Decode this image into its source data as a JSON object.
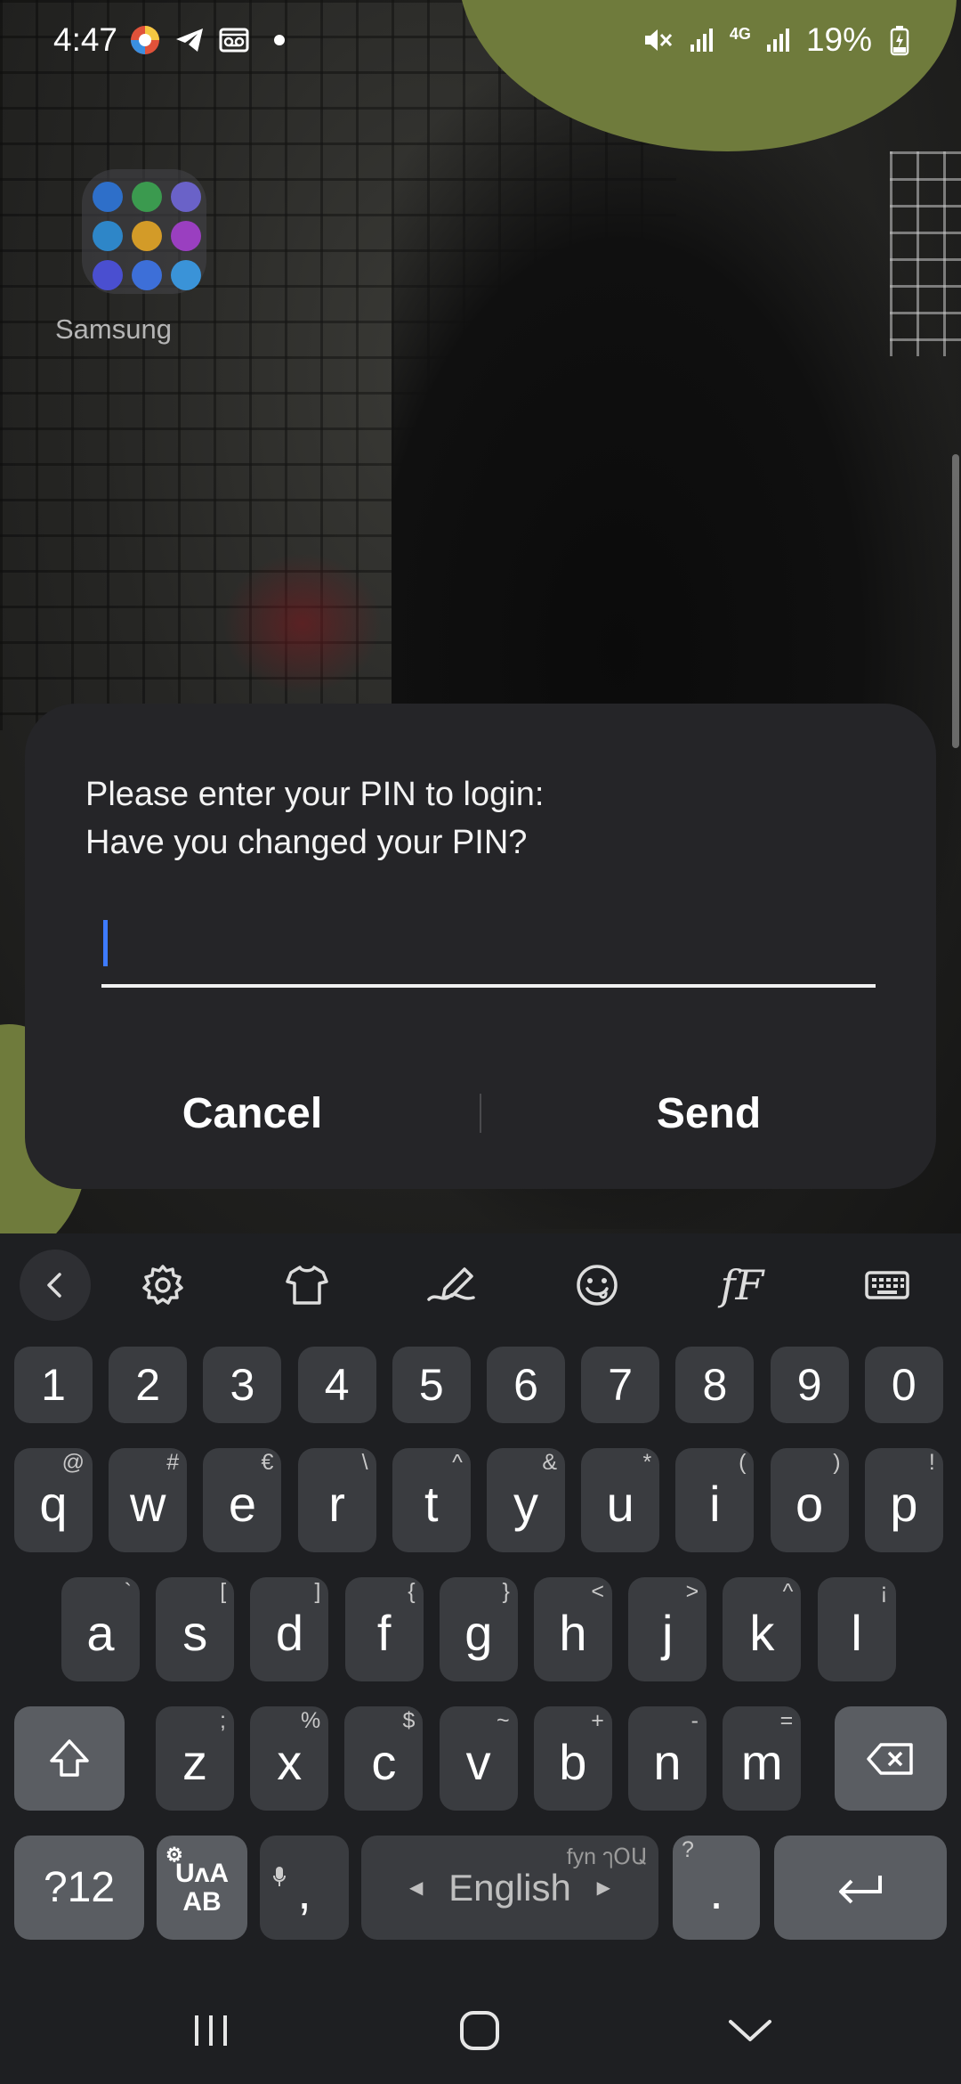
{
  "status_bar": {
    "time": "4:47",
    "network": "4G",
    "battery": "19%",
    "icons": [
      "browser-icon",
      "telegram-icon",
      "voicemail-icon",
      "dot-icon",
      "mute-icon",
      "signal-icon",
      "battery-charging-icon"
    ]
  },
  "home": {
    "folder_label": "Samsung",
    "folder_apps": [
      "#2e6fc9",
      "#3b9a4f",
      "#6a62c8",
      "#2e86c8",
      "#d39b28",
      "#9a3fc0",
      "#4a4fd0",
      "#3d6fd8",
      "#3a93d8"
    ]
  },
  "dialog": {
    "message_line1": "Please enter your PIN to login:",
    "message_line2": "Have you changed your PIN?",
    "pin_value": "",
    "cancel_label": "Cancel",
    "send_label": "Send",
    "cursor_color": "#3e7bff"
  },
  "keyboard": {
    "toolbar": [
      "back-icon",
      "gear-icon",
      "theme-shirt-icon",
      "handwriting-icon",
      "emoji-icon",
      "font-style-icon",
      "keyboard-icon"
    ],
    "font_style_label": "fF",
    "number_row": [
      "1",
      "2",
      "3",
      "4",
      "5",
      "6",
      "7",
      "8",
      "9",
      "0"
    ],
    "row1": [
      {
        "main": "q",
        "alt": "@"
      },
      {
        "main": "w",
        "alt": "#"
      },
      {
        "main": "e",
        "alt": "€"
      },
      {
        "main": "r",
        "alt": "\\"
      },
      {
        "main": "t",
        "alt": "^"
      },
      {
        "main": "y",
        "alt": "&"
      },
      {
        "main": "u",
        "alt": "*"
      },
      {
        "main": "i",
        "alt": "("
      },
      {
        "main": "o",
        "alt": ")"
      },
      {
        "main": "p",
        "alt": "!"
      }
    ],
    "row2": [
      {
        "main": "a",
        "alt": "`"
      },
      {
        "main": "s",
        "alt": "["
      },
      {
        "main": "d",
        "alt": "]"
      },
      {
        "main": "f",
        "alt": "{"
      },
      {
        "main": "g",
        "alt": "}"
      },
      {
        "main": "h",
        "alt": "<"
      },
      {
        "main": "j",
        "alt": ">"
      },
      {
        "main": "k",
        "alt": "^"
      },
      {
        "main": "l",
        "alt": "¡"
      }
    ],
    "row3": [
      {
        "main": "z",
        "alt": ";"
      },
      {
        "main": "x",
        "alt": "%"
      },
      {
        "main": "c",
        "alt": "$"
      },
      {
        "main": "v",
        "alt": "~"
      },
      {
        "main": "b",
        "alt": "+"
      },
      {
        "main": "n",
        "alt": "-"
      },
      {
        "main": "m",
        "alt": "="
      }
    ],
    "symbols_label": "?12",
    "lang_switch_top": "UʌA",
    "lang_switch_bottom": "AB",
    "comma_label": ",",
    "space_label": "English",
    "space_hint": "fyn ๅՕԱ",
    "period_label": ".",
    "period_alt": "?"
  },
  "nav_bar": {
    "icons": [
      "recents-icon",
      "home-icon",
      "back-chevron-icon"
    ]
  }
}
